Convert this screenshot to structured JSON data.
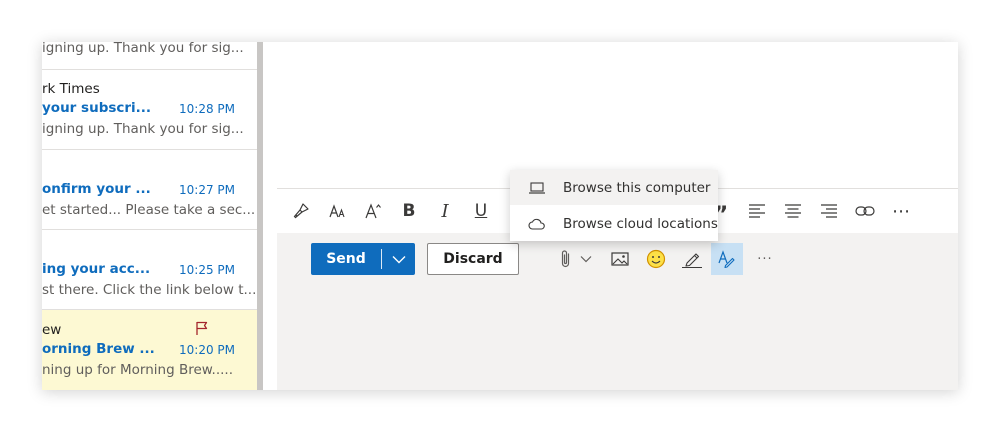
{
  "message_list": [
    {
      "sender": "",
      "subject": "",
      "time": "",
      "preview": "igning up. Thank you for sig...",
      "flagged": false
    },
    {
      "sender": "rk Times",
      "subject": " your subscri...",
      "time": "10:28 PM",
      "preview": "igning up. Thank you for sig...",
      "flagged": false
    },
    {
      "sender": "",
      "subject": "onfirm your ...",
      "time": "10:27 PM",
      "preview": "et started... Please take a sec...",
      "flagged": false
    },
    {
      "sender": "",
      "subject": "ing your acc...",
      "time": "10:25 PM",
      "preview": "st there. Click the link below t...",
      "flagged": false
    },
    {
      "sender": "ew",
      "subject": "orning Brew ...",
      "time": "10:20 PM",
      "preview": "ning up for Morning Brew.....",
      "flagged": true
    }
  ],
  "format_toolbar": {
    "font_size_glyph": "A",
    "bold": "B",
    "italic": "I",
    "underline": "U",
    "quote": "”",
    "more": "⋯"
  },
  "actions": {
    "send_label": "Send",
    "discard_label": "Discard",
    "more": "···"
  },
  "attach_menu": {
    "items": [
      {
        "label": "Browse this computer",
        "icon": "laptop-icon"
      },
      {
        "label": "Browse cloud locations",
        "icon": "cloud-icon"
      }
    ]
  },
  "colors": {
    "accent": "#0f6cbd",
    "flag": "#a4262c",
    "flagged_row_bg": "#fdf9d3",
    "compose_footer_bg": "#f3f2f1"
  }
}
